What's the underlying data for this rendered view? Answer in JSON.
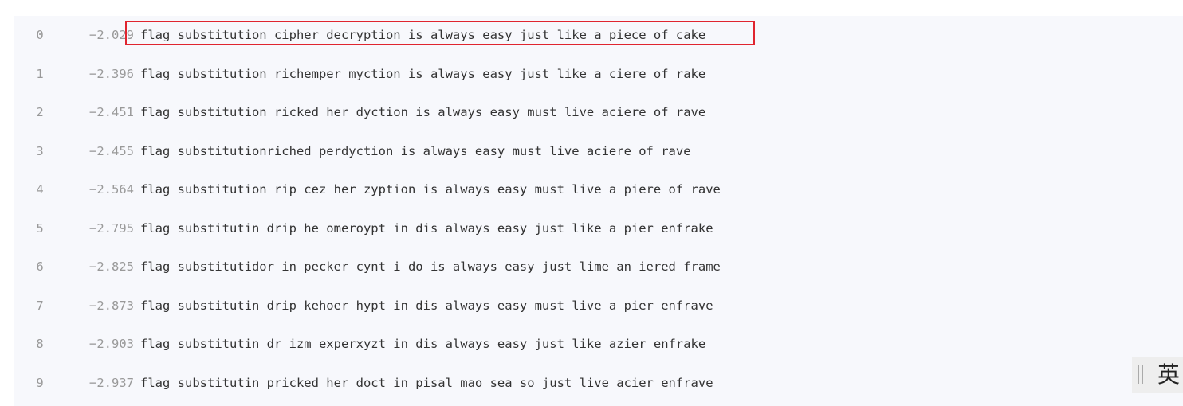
{
  "results": [
    {
      "index": "0",
      "score": "−2.029",
      "text": "flag substitution cipher decryption is always easy just like a piece of cake"
    },
    {
      "index": "1",
      "score": "−2.396",
      "text": "flag substitution richemper myction is always easy just like a ciere of rake"
    },
    {
      "index": "2",
      "score": "−2.451",
      "text": "flag substitution ricked her dyction is always easy must live aciere of rave"
    },
    {
      "index": "3",
      "score": "−2.455",
      "text": "flag substitutionriched perdyction is always easy must live aciere of rave"
    },
    {
      "index": "4",
      "score": "−2.564",
      "text": "flag substitution rip cez her zyption is always easy must live a piere of rave"
    },
    {
      "index": "5",
      "score": "−2.795",
      "text": "flag substitutin drip he omeroypt in dis always easy just like a pier enfrake"
    },
    {
      "index": "6",
      "score": "−2.825",
      "text": "flag substitutidor in pecker cynt i do is always easy just lime an iered frame"
    },
    {
      "index": "7",
      "score": "−2.873",
      "text": "flag substitutin drip kehoer hypt in dis always easy must live a pier enfrave"
    },
    {
      "index": "8",
      "score": "−2.903",
      "text": "flag substitutin dr izm experxyzt in dis always easy just like azier enfrake"
    },
    {
      "index": "9",
      "score": "−2.937",
      "text": "flag substitutin pricked her doct in pisal mao sea so just live acier enfrave"
    }
  ],
  "ime": {
    "language_label": "英"
  },
  "colors": {
    "highlight_border": "#e0252f",
    "panel_background": "#f7f8fc"
  }
}
